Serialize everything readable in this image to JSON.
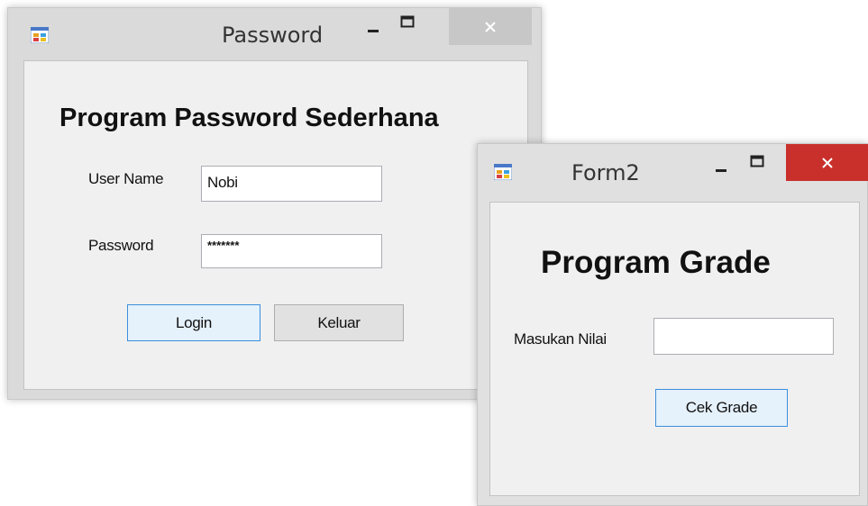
{
  "password_window": {
    "title": "Password",
    "heading": "Program Password Sederhana",
    "username_label": "User Name",
    "username_value": "Nobi",
    "password_label": "Password",
    "password_value": "*******",
    "login_button": "Login",
    "exit_button": "Keluar"
  },
  "form2_window": {
    "title": "Form2",
    "heading": "Program Grade",
    "nilai_label": "Masukan Nilai",
    "nilai_value": "",
    "check_button": "Cek Grade"
  },
  "colors": {
    "close_active": "#c9302c",
    "close_inactive": "#c7c7c7",
    "focus_border": "#3c8fdc"
  },
  "icons": [
    "app-icon",
    "minimize-icon",
    "maximize-icon",
    "close-icon"
  ]
}
